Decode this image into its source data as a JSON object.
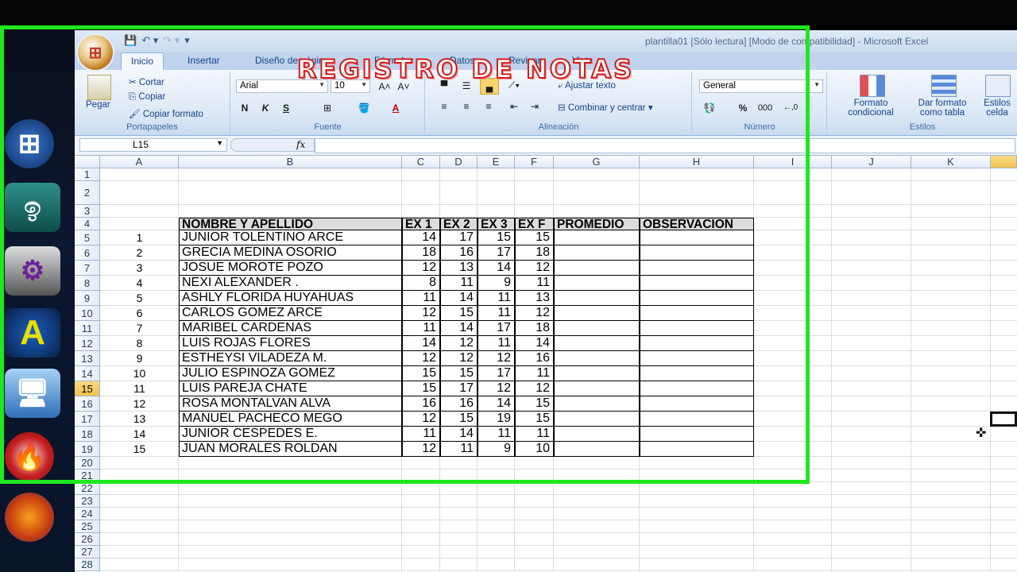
{
  "window": {
    "title": "plantilla01  [Sólo lectura]  [Modo de compatibilidad] - Microsoft Excel"
  },
  "tabs": [
    "Inicio",
    "Insertar",
    "Diseño de página",
    "Fórmulas",
    "Datos",
    "Revisar",
    "Vista"
  ],
  "ribbon": {
    "clipboard": {
      "paste": "Pegar",
      "cut": "Cortar",
      "copy": "Copiar",
      "format_painter": "Copiar formato",
      "label": "Portapapeles"
    },
    "font": {
      "name": "Arial",
      "size": "10",
      "bold": "N",
      "italic": "K",
      "underline": "S",
      "label": "Fuente"
    },
    "alignment": {
      "wrap": "Ajustar texto",
      "merge": "Combinar y centrar",
      "label": "Alineación"
    },
    "number": {
      "format": "General",
      "percent": "%",
      "thousands": "000",
      "label": "Número"
    },
    "styles": {
      "conditional": "Formato condicional",
      "table": "Dar formato como tabla",
      "cell": "Estilos celda",
      "label": "Estilos"
    }
  },
  "formula_bar": {
    "name_box": "L15",
    "fx": "fx",
    "value": ""
  },
  "columns": [
    "A",
    "B",
    "C",
    "D",
    "E",
    "F",
    "G",
    "H",
    "I",
    "J",
    "K"
  ],
  "rows": [
    "1",
    "2",
    "3",
    "4",
    "5",
    "6",
    "7",
    "8",
    "9",
    "10",
    "11",
    "12",
    "13",
    "14",
    "15",
    "16",
    "17",
    "18",
    "19",
    "20",
    "21",
    "22",
    "23",
    "24",
    "25",
    "26",
    "27",
    "28"
  ],
  "sheet": {
    "title": "REGISTRO DE NOTAS",
    "headers": [
      "NOMBRE Y APELLIDO",
      "EX 1",
      "EX 2",
      "EX 3",
      "EX F",
      "PROMEDIO",
      "OBSERVACION"
    ],
    "records": [
      {
        "n": "1",
        "name": "JUNIOR TOLENTINO ARCE",
        "ex1": "14",
        "ex2": "17",
        "ex3": "15",
        "exf": "15"
      },
      {
        "n": "2",
        "name": "GRECIA MEDINA OSORIO",
        "ex1": "18",
        "ex2": "16",
        "ex3": "17",
        "exf": "18"
      },
      {
        "n": "3",
        "name": "JOSUE MOROTE POZO",
        "ex1": "12",
        "ex2": "13",
        "ex3": "14",
        "exf": "12"
      },
      {
        "n": "4",
        "name": "NEXI ALEXANDER .",
        "ex1": "8",
        "ex2": "11",
        "ex3": "9",
        "exf": "11"
      },
      {
        "n": "5",
        "name": "ASHLY FLORIDA HUYAHUAS",
        "ex1": "11",
        "ex2": "14",
        "ex3": "11",
        "exf": "13"
      },
      {
        "n": "6",
        "name": "CARLOS GOMEZ ARCE",
        "ex1": "12",
        "ex2": "15",
        "ex3": "11",
        "exf": "12"
      },
      {
        "n": "7",
        "name": "MARIBEL CARDENAS",
        "ex1": "11",
        "ex2": "14",
        "ex3": "17",
        "exf": "18"
      },
      {
        "n": "8",
        "name": "LUIS ROJAS FLORES",
        "ex1": "14",
        "ex2": "12",
        "ex3": "11",
        "exf": "14"
      },
      {
        "n": "9",
        "name": "ESTHEYSI VILADEZA M.",
        "ex1": "12",
        "ex2": "12",
        "ex3": "12",
        "exf": "16"
      },
      {
        "n": "10",
        "name": "JULIO ESPINOZA GOMEZ",
        "ex1": "15",
        "ex2": "15",
        "ex3": "17",
        "exf": "11"
      },
      {
        "n": "11",
        "name": "LUIS PAREJA CHATE",
        "ex1": "15",
        "ex2": "17",
        "ex3": "12",
        "exf": "12"
      },
      {
        "n": "12",
        "name": "ROSA MONTALVAN ALVA",
        "ex1": "16",
        "ex2": "16",
        "ex3": "14",
        "exf": "15"
      },
      {
        "n": "13",
        "name": "MANUEL PACHECO MEGO",
        "ex1": "12",
        "ex2": "15",
        "ex3": "19",
        "exf": "15"
      },
      {
        "n": "14",
        "name": "JUNIOR CESPEDES E.",
        "ex1": "11",
        "ex2": "14",
        "ex3": "11",
        "exf": "11"
      },
      {
        "n": "15",
        "name": "JUAN MORALES ROLDAN",
        "ex1": "12",
        "ex2": "11",
        "ex3": "9",
        "exf": "10"
      }
    ]
  },
  "selected": {
    "row": "15",
    "cell": "L15"
  },
  "colors": {
    "frame": "#1ee81e",
    "title_red": "#d41a1a",
    "header_fill": "#dcdcdc"
  }
}
